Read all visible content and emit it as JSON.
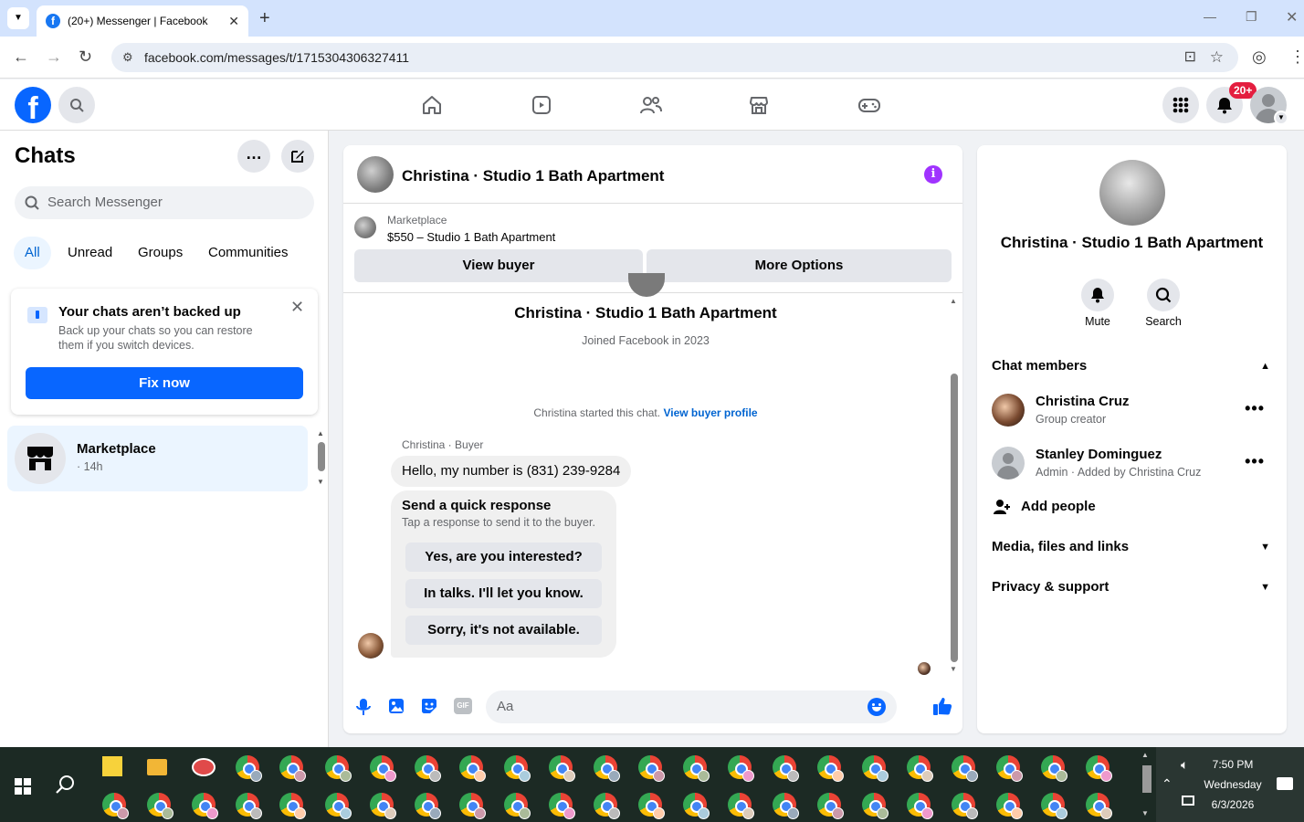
{
  "browser": {
    "tab_title": "(20+) Messenger | Facebook",
    "url": "facebook.com/messages/t/1715304306327411"
  },
  "fbnav": {
    "notification_badge": "20+"
  },
  "left": {
    "title": "Chats",
    "search_placeholder": "Search Messenger",
    "filters": [
      "All",
      "Unread",
      "Groups",
      "Communities"
    ],
    "backup": {
      "title": "Your chats aren’t backed up",
      "body": "Back up your chats so you can restore them if you switch devices.",
      "button": "Fix now"
    },
    "chat_item": {
      "name": "Marketplace",
      "meta": "· 14h"
    }
  },
  "chat": {
    "header_title": "Christina · Studio 1 Bath Apartment",
    "listing_source": "Marketplace",
    "listing_title": "$550 – Studio 1 Bath Apartment",
    "view_buyer": "View buyer",
    "more_options": "More Options",
    "profile_name": "Christina · Studio 1 Bath Apartment",
    "joined": "Joined Facebook in 2023",
    "started": "Christina started this chat.",
    "view_profile_link": "View buyer profile",
    "sender_label": "Christina · Buyer",
    "message": "Hello, my number is (831) 239-9284",
    "quick_title": "Send a quick response",
    "quick_sub": "Tap a response to send it to the buyer.",
    "quick_responses": [
      "Yes, are you interested?",
      "In talks. I'll let you know.",
      "Sorry, it's not available."
    ],
    "composer_placeholder": "Aa"
  },
  "right": {
    "name": "Christina · Studio 1 Bath Apartment",
    "mute": "Mute",
    "search": "Search",
    "members_header": "Chat members",
    "members": [
      {
        "name": "Christina Cruz",
        "role": "Group creator"
      },
      {
        "name": "Stanley Dominguez",
        "role": "Admin · Added by Christina Cruz"
      }
    ],
    "add_people": "Add people",
    "media": "Media, files and links",
    "privacy": "Privacy & support"
  },
  "taskbar": {
    "time": "7:50 PM",
    "day": "Wednesday",
    "date": "6/3/2026"
  },
  "colors": {
    "facebook_blue": "#0866ff",
    "link_blue": "#0064d1",
    "badge_red": "#e41e3f",
    "info_purple": "#a033ff"
  }
}
